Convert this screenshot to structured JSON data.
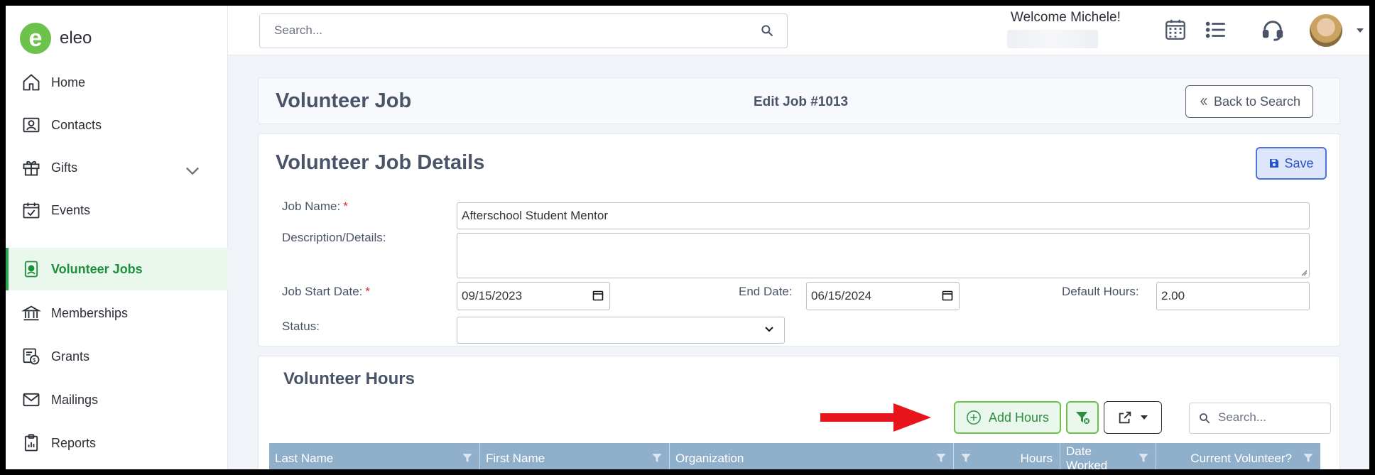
{
  "app": {
    "logo_letter": "e",
    "logo_name": "eleo",
    "brand_color": "#6cc24a"
  },
  "sidebar": {
    "items": [
      {
        "label": "Home",
        "icon": "home-icon"
      },
      {
        "label": "Contacts",
        "icon": "contacts-icon"
      },
      {
        "label": "Gifts",
        "icon": "gift-icon",
        "expandable": true
      },
      {
        "label": "Events",
        "icon": "calendar-check-icon"
      },
      {
        "label": "Volunteer Jobs",
        "icon": "volunteer-badge-icon",
        "active": true
      },
      {
        "label": "Memberships",
        "icon": "bank-icon"
      },
      {
        "label": "Grants",
        "icon": "grant-money-icon"
      },
      {
        "label": "Mailings",
        "icon": "envelope-icon"
      },
      {
        "label": "Reports",
        "icon": "clipboard-chart-icon"
      }
    ]
  },
  "header": {
    "search_placeholder": "Search...",
    "welcome": "Welcome Michele!"
  },
  "title_bar": {
    "title": "Volunteer Job",
    "edit_label": "Edit Job #1013",
    "back_label": "Back to Search"
  },
  "details": {
    "title": "Volunteer Job Details",
    "save_label": "Save",
    "job_name_label": "Job Name:",
    "job_name_value": "Afterschool Student Mentor",
    "description_label": "Description/Details:",
    "description_value": "",
    "start_label": "Job Start Date:",
    "start_value": "09/15/2023",
    "end_label": "End Date:",
    "end_value": "06/15/2024",
    "default_hours_label": "Default Hours:",
    "default_hours_value": "2.00",
    "status_label": "Status:",
    "status_value": ""
  },
  "hours": {
    "title": "Volunteer Hours",
    "add_label": "Add Hours",
    "search_placeholder": "Search...",
    "columns": [
      "Last Name",
      "First Name",
      "Organization",
      "Hours",
      "Date Worked",
      "Current Volunteer?"
    ]
  },
  "colors": {
    "active_nav": "#1f8f3a",
    "save_blue": "#2a52c9",
    "grid_header": "#8fafcb",
    "arrow_red": "#e8141c"
  }
}
